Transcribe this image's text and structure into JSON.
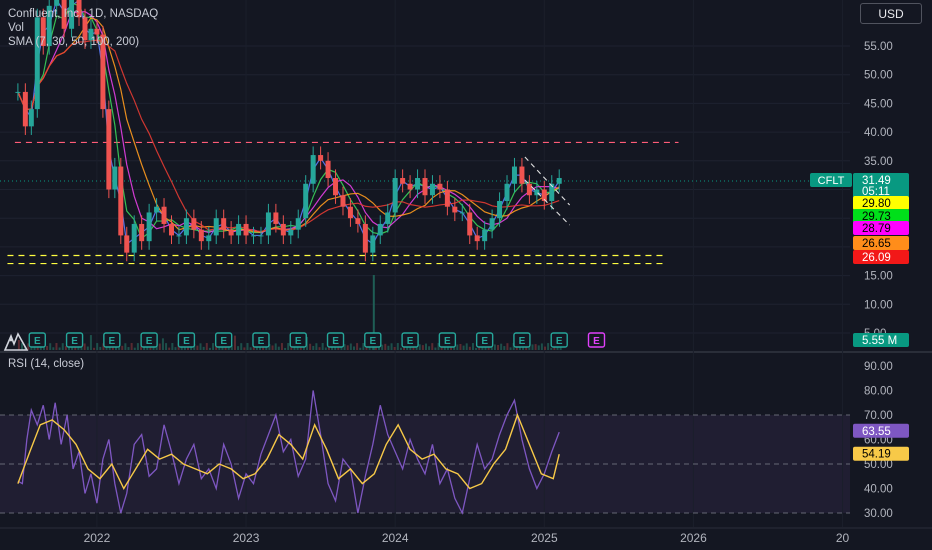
{
  "header": {
    "symbol_line": "Confluent, Inc., 1D, NASDAQ",
    "vol_label": "Vol",
    "sma_label": "SMA (7, 30, 50, 100, 200)",
    "currency_button": "USD"
  },
  "rsi": {
    "title": "RSI (14, close)"
  },
  "chart_data": [
    {
      "type": "line",
      "title": "Confluent, Inc., 1D, NASDAQ",
      "x_ticks": [
        "2022",
        "2023",
        "2024",
        "2025",
        "2026",
        "20"
      ],
      "y_ticks": [
        5,
        10,
        15,
        20,
        25,
        30,
        35,
        40,
        45,
        50,
        55
      ],
      "y_tick_labels": [
        "5.00",
        "10.00",
        "15.00",
        "20.00",
        "25.00",
        "30.00",
        "35.00",
        "40.00",
        "45.00",
        "50.00",
        "55.00"
      ],
      "ylim": [
        0,
        61
      ],
      "xlim": [
        2021.35,
        2027.05
      ],
      "price_series": {
        "x": [
          2021.47,
          2021.52,
          2021.56,
          2021.6,
          2021.64,
          2021.68,
          2021.73,
          2021.78,
          2021.83,
          2021.88,
          2021.92,
          2021.96,
          2022.0,
          2022.04,
          2022.08,
          2022.12,
          2022.16,
          2022.2,
          2022.25,
          2022.3,
          2022.35,
          2022.4,
          2022.45,
          2022.5,
          2022.55,
          2022.6,
          2022.65,
          2022.7,
          2022.75,
          2022.8,
          2022.85,
          2022.9,
          2022.95,
          2023.0,
          2023.05,
          2023.1,
          2023.15,
          2023.2,
          2023.25,
          2023.3,
          2023.35,
          2023.4,
          2023.45,
          2023.5,
          2023.55,
          2023.6,
          2023.65,
          2023.7,
          2023.75,
          2023.8,
          2023.85,
          2023.9,
          2023.95,
          2024.0,
          2024.05,
          2024.1,
          2024.15,
          2024.2,
          2024.25,
          2024.3,
          2024.35,
          2024.4,
          2024.45,
          2024.5,
          2024.55,
          2024.6,
          2024.65,
          2024.7,
          2024.75,
          2024.8,
          2024.85,
          2024.9,
          2024.95,
          2025.0,
          2025.05,
          2025.1
        ],
        "y": [
          47,
          41,
          44,
          60,
          55,
          62,
          64,
          58,
          66,
          60,
          56,
          58,
          57,
          44,
          30,
          34,
          22,
          19,
          24,
          21,
          26,
          27,
          24,
          22,
          22,
          25,
          23,
          21,
          22,
          25,
          23,
          22,
          24,
          22,
          22,
          22,
          26,
          24,
          22,
          23,
          25,
          31,
          36,
          35,
          32,
          29,
          27,
          25,
          24,
          19,
          22,
          24,
          26,
          32,
          31,
          30,
          32,
          29,
          31,
          30,
          27,
          26,
          26,
          22,
          21,
          23,
          25,
          28,
          31,
          34,
          31,
          29,
          30,
          28,
          31,
          32
        ]
      },
      "sma_series": [
        {
          "name": "7",
          "color": "#5b7cff"
        },
        {
          "name": "30",
          "color": "#3bd15a"
        },
        {
          "name": "50",
          "color": "#e63fe6"
        },
        {
          "name": "100",
          "color": "#ff9b1e"
        },
        {
          "name": "200",
          "color": "#e33b33"
        }
      ],
      "horizontal_levels": [
        {
          "value": 38.2,
          "color": "#ff5c78",
          "style": "dashed"
        },
        {
          "value": 18.5,
          "color": "#ffff40",
          "style": "dashed"
        },
        {
          "value": 17.1,
          "color": "#ffff40",
          "style": "dashed"
        }
      ],
      "price_labels": [
        {
          "value": "31.49",
          "color": "#089981",
          "prefix": "CFLT"
        },
        {
          "value": "05:11",
          "color": "#089981"
        },
        {
          "value": "29.80",
          "color": "#ffff00",
          "text_color": "#000000"
        },
        {
          "value": "29.73",
          "color": "#00e01a",
          "text_color": "#000000"
        },
        {
          "value": "28.79",
          "color": "#ff00ff",
          "text_color": "#000000"
        },
        {
          "value": "26.65",
          "color": "#ff8d1a",
          "text_color": "#000000"
        },
        {
          "value": "26.09",
          "color": "#f21818",
          "text_color": "#ffffff"
        },
        {
          "value": "5.55 M",
          "color": "#089981"
        }
      ],
      "earnings_markers": {
        "label": "E",
        "count": 16
      }
    },
    {
      "type": "line",
      "title": "RSI (14, close)",
      "y_ticks": [
        30,
        40,
        50,
        60,
        70,
        80,
        90
      ],
      "y_tick_labels": [
        "30.00",
        "40.00",
        "50.00",
        "60.00",
        "70.00",
        "80.00",
        "90.00"
      ],
      "ylim": [
        25,
        95
      ],
      "bands": [
        70,
        50,
        30
      ],
      "series": [
        {
          "color": "#7e57c2",
          "x": [
            2021.47,
            2021.5,
            2021.53,
            2021.56,
            2021.6,
            2021.64,
            2021.68,
            2021.72,
            2021.76,
            2021.8,
            2021.84,
            2021.88,
            2021.92,
            2021.96,
            2022.0,
            2022.04,
            2022.08,
            2022.12,
            2022.16,
            2022.2,
            2022.25,
            2022.3,
            2022.35,
            2022.4,
            2022.45,
            2022.5,
            2022.55,
            2022.6,
            2022.65,
            2022.7,
            2022.75,
            2022.8,
            2022.85,
            2022.9,
            2022.95,
            2023.0,
            2023.05,
            2023.1,
            2023.15,
            2023.2,
            2023.25,
            2023.3,
            2023.35,
            2023.4,
            2023.45,
            2023.5,
            2023.55,
            2023.6,
            2023.65,
            2023.7,
            2023.75,
            2023.8,
            2023.85,
            2023.9,
            2023.95,
            2024.0,
            2024.05,
            2024.1,
            2024.15,
            2024.2,
            2024.25,
            2024.3,
            2024.35,
            2024.4,
            2024.45,
            2024.5,
            2024.55,
            2024.6,
            2024.65,
            2024.7,
            2024.75,
            2024.8,
            2024.85,
            2024.9,
            2024.95,
            2025.0,
            2025.05,
            2025.1
          ],
          "y": [
            43,
            42,
            60,
            72,
            66,
            74,
            60,
            75,
            58,
            70,
            48,
            55,
            38,
            46,
            34,
            52,
            60,
            42,
            30,
            38,
            58,
            62,
            45,
            48,
            66,
            55,
            42,
            52,
            58,
            44,
            48,
            40,
            58,
            50,
            36,
            46,
            42,
            54,
            62,
            70,
            55,
            60,
            45,
            52,
            80,
            62,
            42,
            35,
            52,
            48,
            30,
            45,
            58,
            74,
            62,
            55,
            48,
            60,
            52,
            46,
            58,
            42,
            48,
            36,
            30,
            44,
            58,
            48,
            52,
            62,
            70,
            76,
            60,
            48,
            40,
            46,
            55,
            63
          ]
        },
        {
          "color": "#f7c948",
          "x": [
            2021.47,
            2021.55,
            2021.62,
            2021.7,
            2021.78,
            2021.86,
            2021.94,
            2022.02,
            2022.1,
            2022.18,
            2022.26,
            2022.34,
            2022.42,
            2022.5,
            2022.58,
            2022.66,
            2022.74,
            2022.82,
            2022.9,
            2022.98,
            2023.06,
            2023.14,
            2023.22,
            2023.3,
            2023.38,
            2023.46,
            2023.54,
            2023.62,
            2023.7,
            2023.78,
            2023.86,
            2023.94,
            2024.02,
            2024.1,
            2024.18,
            2024.26,
            2024.34,
            2024.42,
            2024.5,
            2024.58,
            2024.66,
            2024.74,
            2024.82,
            2024.9,
            2024.98,
            2025.06,
            2025.1
          ],
          "y": [
            42,
            55,
            66,
            68,
            64,
            58,
            48,
            44,
            50,
            40,
            48,
            56,
            52,
            54,
            50,
            48,
            46,
            50,
            48,
            44,
            46,
            52,
            62,
            58,
            52,
            66,
            56,
            44,
            48,
            42,
            46,
            58,
            66,
            56,
            52,
            54,
            48,
            46,
            40,
            42,
            50,
            56,
            70,
            58,
            46,
            44,
            54
          ]
        }
      ],
      "value_labels": [
        {
          "value": "63.55",
          "color": "#7e57c2",
          "text_color": "#ffffff"
        },
        {
          "value": "54.19",
          "color": "#f7c948",
          "text_color": "#000000"
        }
      ]
    }
  ]
}
